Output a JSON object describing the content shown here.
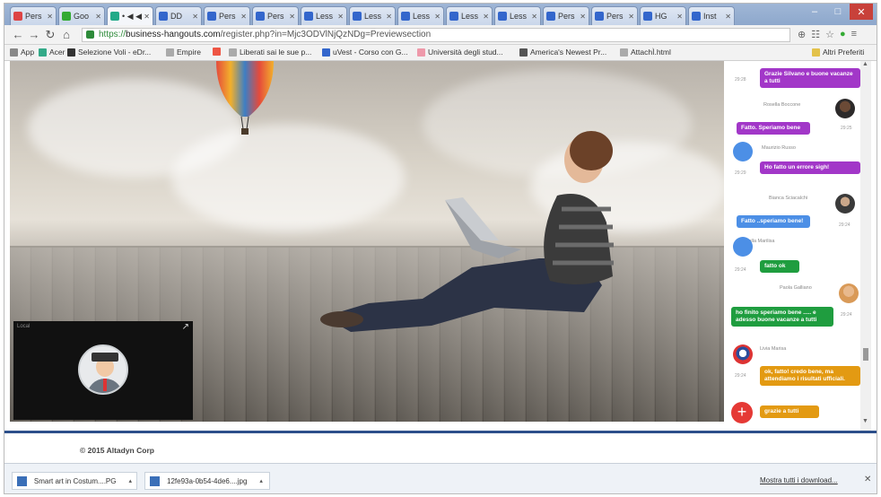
{
  "browser": {
    "tabs": [
      {
        "label": "Pers",
        "color": "#d44"
      },
      {
        "label": "Goo",
        "color": "#3a3"
      },
      {
        "label": "• ◀ ◀",
        "color": "#2a8",
        "active": true
      },
      {
        "label": "DD",
        "color": "#36c"
      },
      {
        "label": "Pers",
        "color": "#36c"
      },
      {
        "label": "Pers",
        "color": "#36c"
      },
      {
        "label": "Less",
        "color": "#36c"
      },
      {
        "label": "Less",
        "color": "#36c"
      },
      {
        "label": "Less",
        "color": "#36c"
      },
      {
        "label": "Less",
        "color": "#36c"
      },
      {
        "label": "Less",
        "color": "#36c"
      },
      {
        "label": "Pers",
        "color": "#36c"
      },
      {
        "label": "Pers",
        "color": "#36c"
      },
      {
        "label": "HG",
        "color": "#36c"
      },
      {
        "label": "Inst",
        "color": "#36c"
      }
    ],
    "address": {
      "secure": "https://",
      "host": "business-hangouts.com",
      "path": "/register.php?in=Mjc3ODVlNjQzNDg=Previewsection"
    },
    "bookmarks": [
      {
        "label": "App",
        "color": "#888"
      },
      {
        "label": "Acer",
        "color": "#3a8"
      },
      {
        "label": "Selezione Voli - eDr...",
        "color": "#333"
      },
      {
        "label": "Empire",
        "color": "#aaa"
      },
      {
        "label": "",
        "color": "#e54"
      },
      {
        "label": "Liberati sai le sue p...",
        "color": "#aaa"
      },
      {
        "label": "uVest - Corso con G...",
        "color": "#36c"
      },
      {
        "label": "Università degli stud...",
        "color": "#e9a"
      },
      {
        "label": "America's Newest Pr...",
        "color": "#555"
      },
      {
        "label": "AttachÌ.html",
        "color": "#aaa"
      }
    ],
    "bookmarks_other": "Altri Preferiti"
  },
  "camera": {
    "label": "Local",
    "expand_icon": "↗"
  },
  "chat": {
    "messages": [
      {
        "type": "bubble",
        "style": "purple",
        "text": "Grazie Silvano e buone vacanze a tutti",
        "time": "29:28"
      },
      {
        "type": "name",
        "text": "Rosella Boccone"
      },
      {
        "type": "bubble",
        "style": "purple",
        "text": "Fatto. Speriamo bene",
        "time": "29:25"
      },
      {
        "type": "name",
        "text": "Maurizio Russo"
      },
      {
        "type": "bubble",
        "style": "purple",
        "text": "Ho fatto un errore sigh!",
        "time": "29:29"
      },
      {
        "type": "name",
        "text": "Bianca Sciacalchi"
      },
      {
        "type": "bubble",
        "style": "blue",
        "text": "Fatto ..speriamo bene!",
        "time": "29:24"
      },
      {
        "type": "name",
        "text": "Gabriella Marilisa"
      },
      {
        "type": "bubble",
        "style": "green",
        "text": "fatto ok",
        "time": "29:24"
      },
      {
        "type": "name",
        "text": "Paola Galliano"
      },
      {
        "type": "bubble",
        "style": "green",
        "text": "ho finito speriamo bene ..... e adesso buone vacanze a tutti",
        "time": "29:24"
      },
      {
        "type": "name",
        "text": "Livia Marisa"
      },
      {
        "type": "bubble",
        "style": "orange",
        "text": "ok, fatto! credo bene, ma attendiamo i risultati ufficiali.",
        "time": "29:24"
      },
      {
        "type": "bubble",
        "style": "orange",
        "text": "grazie a tutti",
        "time": ""
      }
    ],
    "fab_label": "+"
  },
  "footer": {
    "copyright": "© 2015 Altadyn Corp"
  },
  "downloads": {
    "items": [
      {
        "label": "Smart art in Costum....PG"
      },
      {
        "label": "12fe93a-0b54-4de6....jpg"
      }
    ],
    "show_all": "Mostra tutti i download...",
    "close": "✕"
  }
}
